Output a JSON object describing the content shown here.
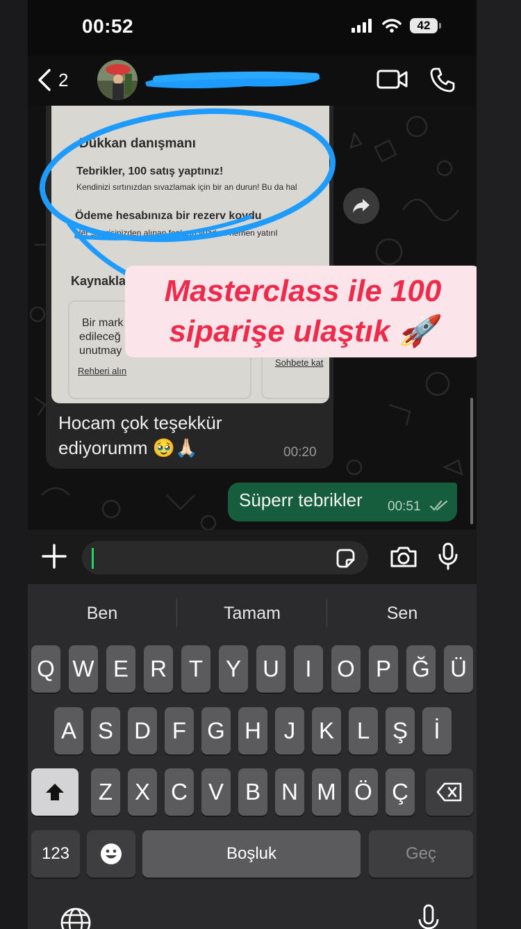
{
  "status_bar": {
    "time": "00:52",
    "battery": "42"
  },
  "header": {
    "back_count": "2"
  },
  "messages": {
    "incoming": {
      "image": {
        "heading": "Dükkan danışmanı",
        "line1_title": "Tebrikler, 100 satış yaptınız!",
        "line1_sub": "Kendinizi sırtınızdan sıvazlamak için bir an durun! Bu da hal",
        "line2_title": "Ödeme hesabınıza bir rezerv koydu",
        "line2_sub": "Her siparişinizden alınan fonların   yüzdesi hemen yatırıl",
        "section_title": "Kaynakla",
        "card_text1": "Bir mark",
        "card_text2": "edileceğ",
        "card_text3": "unutmay",
        "card_link": "Rehberi alın",
        "card2_link": "Sohbete kat"
      },
      "text": "Hocam çok teşekkür ediyorumm 🥹🙏🏻",
      "time": "00:20"
    },
    "sticker_text": "Masterclass ile 100 siparişe ulaştık 🚀",
    "outgoing": {
      "text": "Süperr tebrikler",
      "time": "00:51"
    }
  },
  "keyboard": {
    "suggestions": [
      "Ben",
      "Tamam",
      "Sen"
    ],
    "row1": [
      "Q",
      "W",
      "E",
      "R",
      "T",
      "Y",
      "U",
      "I",
      "O",
      "P",
      "Ğ",
      "Ü"
    ],
    "row2": [
      "A",
      "S",
      "D",
      "F",
      "G",
      "H",
      "J",
      "K",
      "L",
      "Ş",
      "İ"
    ],
    "row3": [
      "Z",
      "X",
      "C",
      "V",
      "B",
      "N",
      "M",
      "Ö",
      "Ç"
    ],
    "numbers_label": "123",
    "space_label": "Boşluk",
    "return_label": "Geç"
  },
  "colors": {
    "accent_green": "#25d366",
    "outgoing_bubble": "#155d3d",
    "sticker_red": "#ef2a4a",
    "annotation_blue": "#1e9bff"
  }
}
